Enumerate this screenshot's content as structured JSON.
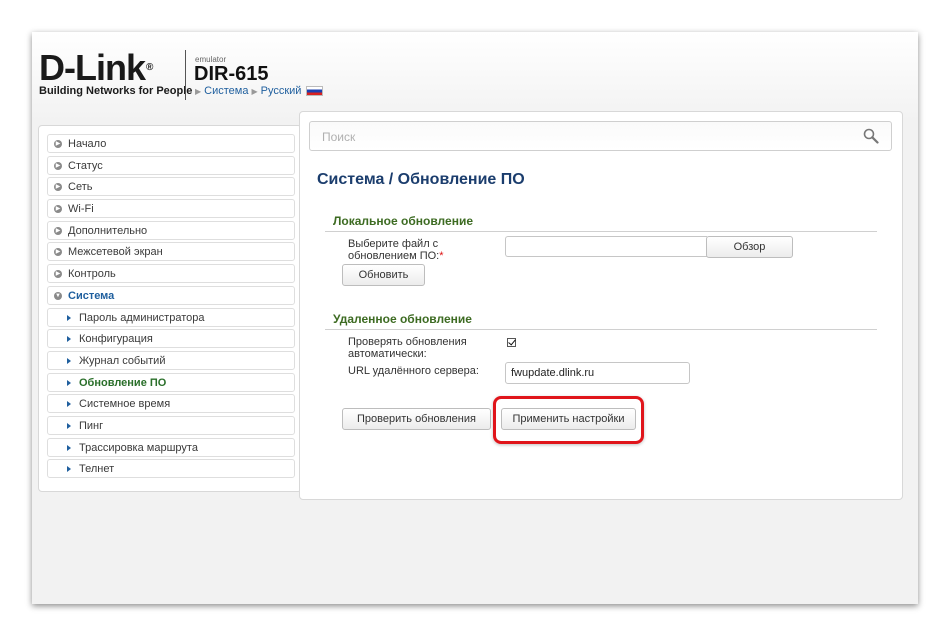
{
  "header": {
    "logo": "D-Link",
    "registered": "®",
    "tagline": "Building Networks for People",
    "emulator": "emulator",
    "model": "DIR-615",
    "breadcrumb": [
      "Система",
      "Русский"
    ]
  },
  "sidebar": {
    "items": [
      {
        "label": "Начало",
        "level": 0,
        "icon": "expand-icon"
      },
      {
        "label": "Статус",
        "level": 0,
        "icon": "expand-icon"
      },
      {
        "label": "Сеть",
        "level": 0,
        "icon": "expand-icon"
      },
      {
        "label": "Wi-Fi",
        "level": 0,
        "icon": "expand-icon"
      },
      {
        "label": "Дополнительно",
        "level": 0,
        "icon": "expand-icon"
      },
      {
        "label": "Межсетевой экран",
        "level": 0,
        "icon": "expand-icon"
      },
      {
        "label": "Контроль",
        "level": 0,
        "icon": "expand-icon"
      },
      {
        "label": "Система",
        "level": 0,
        "icon": "collapse-icon",
        "state": "open"
      },
      {
        "label": "Пароль администратора",
        "level": 1,
        "icon": "arrow-right-icon"
      },
      {
        "label": "Конфигурация",
        "level": 1,
        "icon": "arrow-right-icon"
      },
      {
        "label": "Журнал событий",
        "level": 1,
        "icon": "arrow-right-icon"
      },
      {
        "label": "Обновление ПО",
        "level": 1,
        "icon": "arrow-right-icon",
        "state": "active"
      },
      {
        "label": "Системное время",
        "level": 1,
        "icon": "arrow-right-icon"
      },
      {
        "label": "Пинг",
        "level": 1,
        "icon": "arrow-right-icon"
      },
      {
        "label": "Трассировка маршрута",
        "level": 1,
        "icon": "arrow-right-icon"
      },
      {
        "label": "Телнет",
        "level": 1,
        "icon": "arrow-right-icon"
      }
    ]
  },
  "search": {
    "placeholder": "Поиск",
    "icon": "search-icon"
  },
  "page": {
    "title": "Система /  Обновление ПО"
  },
  "local_update": {
    "title": "Локальное обновление",
    "file_label_line1": "Выберите файл с",
    "file_label_line2": "обновлением ПО:",
    "required_mark": "*",
    "browse_label": "Обзор",
    "update_label": "Обновить"
  },
  "remote_update": {
    "title": "Удаленное обновление",
    "auto_check_line1": "Проверять обновления",
    "auto_check_line2": "автоматически:",
    "auto_check_value": true,
    "url_label": "URL удалённого сервера:",
    "url_value": "fwupdate.dlink.ru",
    "check_button": "Проверить обновления",
    "apply_button": "Применить настройки"
  },
  "colors": {
    "accent_blue": "#1f5f9e",
    "title_blue": "#1b3d6d",
    "section_green": "#3d6b22",
    "active_green": "#2a6f2a",
    "highlight_red": "#e0151b"
  }
}
